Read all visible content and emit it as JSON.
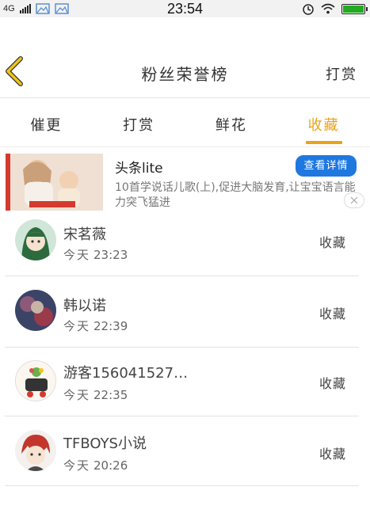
{
  "status_bar": {
    "network": "4G",
    "time": "23:54"
  },
  "header": {
    "title": "粉丝荣誉榜",
    "right_action": "打赏"
  },
  "tabs": [
    {
      "label": "催更",
      "active": false
    },
    {
      "label": "打赏",
      "active": false
    },
    {
      "label": "鲜花",
      "active": false
    },
    {
      "label": "收藏",
      "active": true
    }
  ],
  "ad": {
    "title": "头条lite",
    "button_label": "查看详情",
    "description": "10首学说话儿歌(上),促进大脑发育,让宝宝语言能力突飞猛进"
  },
  "list": [
    {
      "name": "宋茗薇",
      "day": "今天",
      "time": "23:23",
      "action": "收藏"
    },
    {
      "name": "韩以诺",
      "day": "今天",
      "time": "22:39",
      "action": "收藏"
    },
    {
      "name": "游客156041527…",
      "day": "今天",
      "time": "22:35",
      "action": "收藏"
    },
    {
      "name": "TFBOYS小说",
      "day": "今天",
      "time": "20:26",
      "action": "收藏"
    }
  ],
  "colors": {
    "accent": "#e9a21a",
    "ad_button": "#1f78e0",
    "back_arrow": "#f0c419"
  }
}
